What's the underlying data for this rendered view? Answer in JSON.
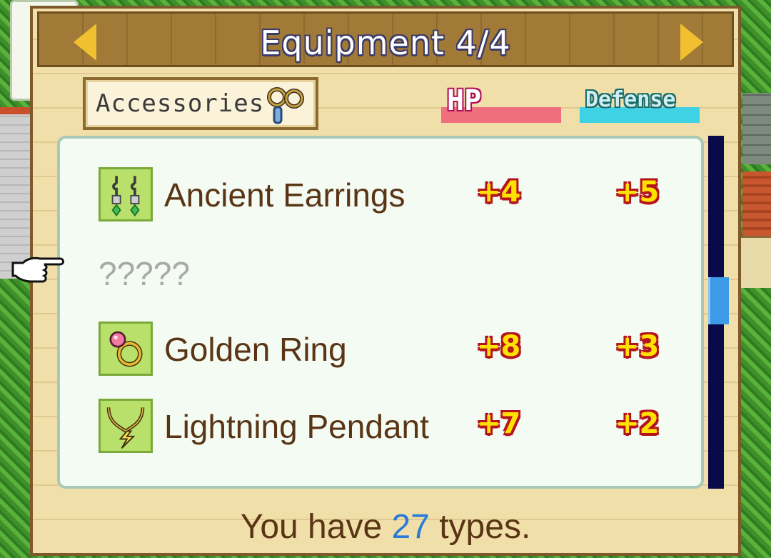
{
  "window": {
    "title": "Equipment 4/4",
    "nav": {
      "prev": "previous-page",
      "next": "next-page"
    }
  },
  "category": {
    "label": "Accessories",
    "icon": "accessories-icon"
  },
  "stat_headers": {
    "hp": "HP",
    "defense": "Defense"
  },
  "items": [
    {
      "name": "Ancient Earrings",
      "hp": "+4",
      "defense": "+5",
      "icon": "earrings-icon",
      "known": true
    },
    {
      "name": "?????",
      "hp": "",
      "defense": "",
      "icon": "",
      "known": false
    },
    {
      "name": "Golden Ring",
      "hp": "+8",
      "defense": "+3",
      "icon": "ring-icon",
      "known": true
    },
    {
      "name": "Lightning Pendant",
      "hp": "+7",
      "defense": "+2",
      "icon": "pendant-icon",
      "known": true
    }
  ],
  "footer": {
    "prefix": "You have ",
    "count": "27",
    "suffix": " types."
  },
  "colors": {
    "panel_bg": "#f1dfa9",
    "title_bar": "#a07a36",
    "hp_bar": "#f06f7f",
    "defense_bar": "#3fd1e4",
    "stat_text": "#ffe100",
    "item_text": "#5a3515",
    "count_text": "#2a7ad8"
  }
}
